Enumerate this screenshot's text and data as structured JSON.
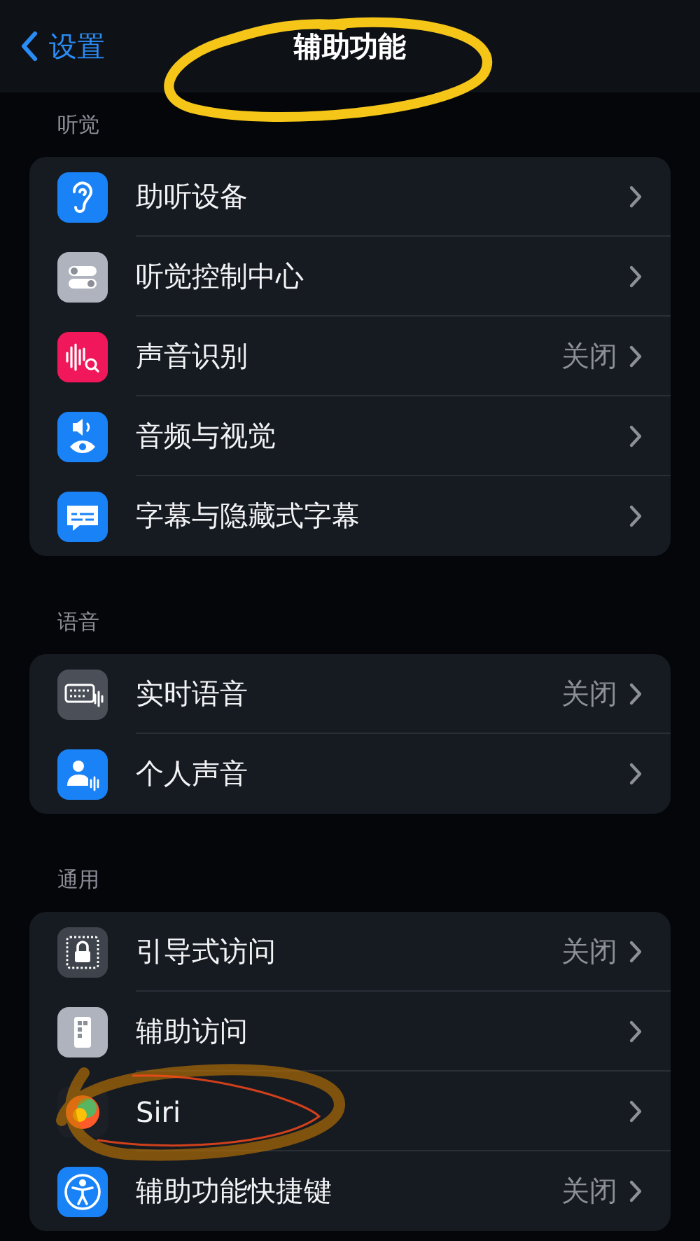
{
  "nav_bar": {
    "back_label": "设置",
    "title": "辅助功能"
  },
  "sections": [
    {
      "header": "听觉",
      "rows": [
        {
          "label": "助听设备",
          "kind": "ear",
          "color": "#1a82f7"
        },
        {
          "label": "听觉控制中心",
          "kind": "toggles",
          "color": "#aeb3bd"
        },
        {
          "label": "声音识别",
          "kind": "waveform",
          "color": "#f0185a",
          "value": "关闭"
        },
        {
          "label": "音频与视觉",
          "kind": "speaker",
          "color": "#1a82f7"
        },
        {
          "label": "字幕与隐藏式字幕",
          "kind": "captions",
          "color": "#1a82f7"
        }
      ]
    },
    {
      "header": "语音",
      "rows": [
        {
          "label": "实时语音",
          "kind": "keyboard",
          "color": "#4a4f58",
          "value": "关闭"
        },
        {
          "label": "个人声音",
          "kind": "person",
          "color": "#1a82f7"
        }
      ]
    },
    {
      "header": "通用",
      "rows": [
        {
          "label": "引导式访问",
          "kind": "lock",
          "color": "#3f444c",
          "value": "关闭"
        },
        {
          "label": "辅助访问",
          "kind": "remote",
          "color": "#aeb3bd"
        },
        {
          "label": "Siri",
          "kind": "orb",
          "color": "#1c1f26"
        },
        {
          "label": "辅助功能快捷键",
          "kind": "accessibility",
          "color": "#1a82f7",
          "value": "关闭"
        }
      ]
    }
  ],
  "annotations": {
    "title_circle": true,
    "siri_scribble": true
  }
}
